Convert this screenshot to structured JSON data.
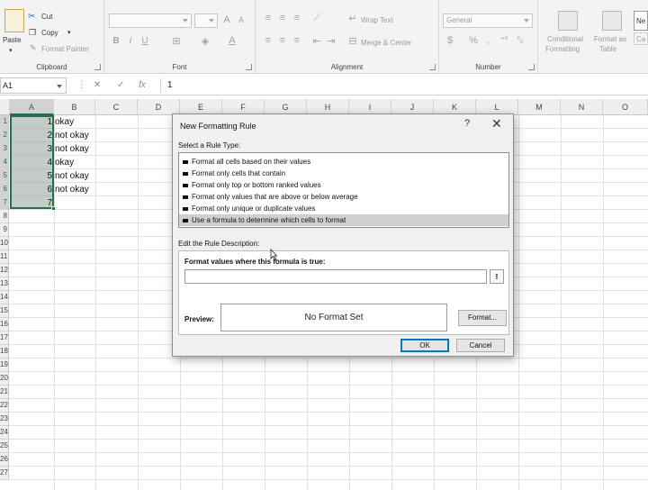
{
  "ribbon": {
    "clipboard": {
      "paste": "Paste",
      "cut": "Cut",
      "copy": "Copy",
      "format_painter": "Format Painter",
      "label": "Clipboard"
    },
    "font": {
      "label": "Font",
      "bold": "B",
      "italic": "I",
      "underline": "U"
    },
    "alignment": {
      "wrap_text": "Wrap Text",
      "merge_center": "Merge & Center",
      "label": "Alignment"
    },
    "number": {
      "format": "General",
      "currency": "$",
      "percent": "%",
      "comma": ",",
      "label": "Number"
    },
    "styles": {
      "conditional": "Conditional",
      "formatting": "Formatting",
      "format_as": "Format as",
      "table": "Table",
      "ne": "Ne",
      "ca": "Ca"
    }
  },
  "formula_bar": {
    "name_box": "A1",
    "cancel": "✕",
    "enter": "✓",
    "fx": "fx",
    "content": "1"
  },
  "columns": [
    "A",
    "B",
    "C",
    "D",
    "E",
    "F",
    "G",
    "H",
    "I",
    "J",
    "K",
    "L",
    "M",
    "N",
    "O"
  ],
  "rows": [
    "1",
    "2",
    "3",
    "4",
    "5",
    "6",
    "7",
    "8",
    "9",
    "10",
    "11",
    "12",
    "13",
    "14",
    "15",
    "16",
    "17",
    "18",
    "19",
    "20",
    "21",
    "22",
    "23",
    "24",
    "25",
    "26",
    "27"
  ],
  "cells": [
    {
      "a": "1",
      "b": "okay"
    },
    {
      "a": "2",
      "b": "not okay"
    },
    {
      "a": "3",
      "b": "not okay"
    },
    {
      "a": "4",
      "b": "okay"
    },
    {
      "a": "5",
      "b": "not okay"
    },
    {
      "a": "6",
      "b": "not okay"
    },
    {
      "a": "7",
      "b": ""
    }
  ],
  "dialog": {
    "title": "New Formatting Rule",
    "help": "?",
    "close": "✕",
    "select_type_label": "Select a Rule Type:",
    "rule_types": [
      "Format all cells based on their values",
      "Format only cells that contain",
      "Format only top or bottom ranked values",
      "Format only values that are above or below average",
      "Format only unique or duplicate values",
      "Use a formula to determine which cells to format"
    ],
    "selected_rule_index": 5,
    "edit_label": "Edit the Rule Description:",
    "formula_label": "Format values where this formula is true:",
    "formula_value": "",
    "preview_label": "Preview:",
    "preview_text": "No Format Set",
    "format_button": "Format...",
    "ok_button": "OK",
    "cancel_button": "Cancel"
  },
  "colors": {
    "accent_green": "#217346",
    "selected_range": "#96a09b",
    "dialog_bg": "#f0f0f0",
    "ok_border": "#0078d7"
  }
}
